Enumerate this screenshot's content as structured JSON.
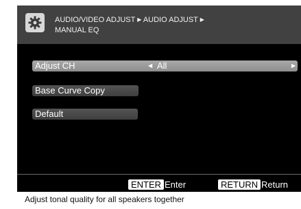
{
  "header": {
    "icon": "gear-icon",
    "breadcrumb_line1": "AUDIO/VIDEO ADJUST",
    "breadcrumb_sep1": "▶",
    "breadcrumb_line1b": "AUDIO ADJUST",
    "breadcrumb_sep2": "▶",
    "breadcrumb_line2": "MANUAL EQ"
  },
  "menu": {
    "adjust_ch": {
      "label": "Adjust CH",
      "left_arrow": "◀",
      "value": "All",
      "right_arrow": "▶"
    },
    "base_curve_copy": "Base Curve Copy",
    "default": "Default"
  },
  "footer": {
    "enter_key": "ENTER",
    "enter_action": "Enter",
    "return_key": "RETURN",
    "return_action": "Return"
  },
  "help_text": "Adjust tonal quality for all speakers together",
  "colors": {
    "screen_bg": "#000000",
    "header_bg": "#414141",
    "selected_item": "#9a9a9a",
    "item_bg": "#4a4a4a"
  }
}
